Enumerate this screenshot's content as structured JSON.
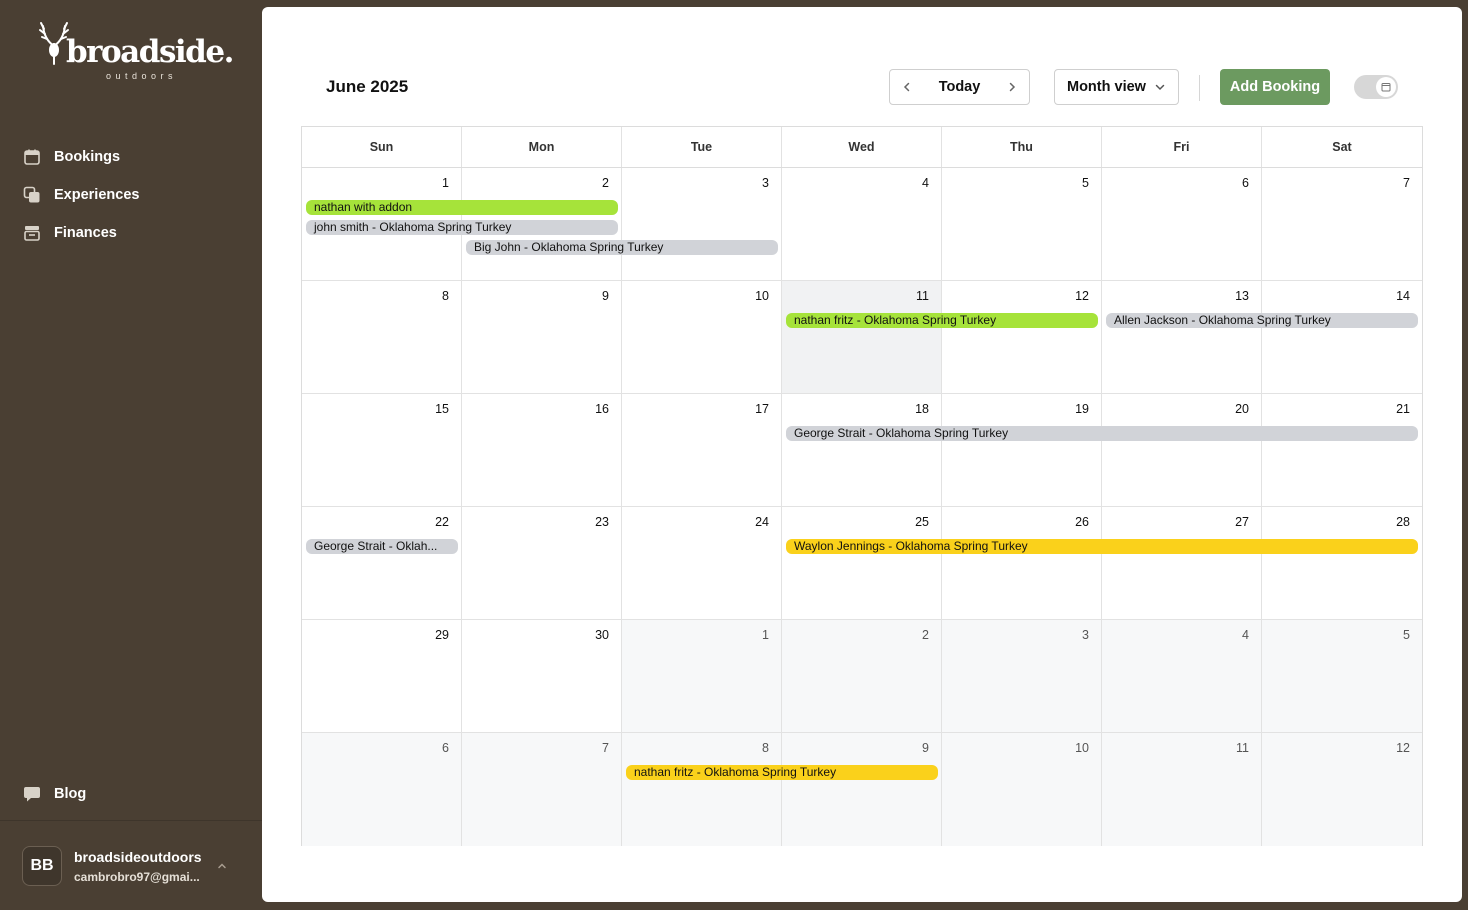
{
  "brand": {
    "name": "broadside.",
    "tagline": "outdoors"
  },
  "nav": [
    {
      "label": "Bookings",
      "icon": "calendar-icon"
    },
    {
      "label": "Experiences",
      "icon": "copy-icon"
    },
    {
      "label": "Finances",
      "icon": "archive-icon"
    }
  ],
  "blog": {
    "label": "Blog",
    "icon": "message-icon"
  },
  "user": {
    "initials": "BB",
    "name": "broadsideoutdoors",
    "email": "cambrobro97@gmai..."
  },
  "header": {
    "title": "June 2025",
    "today_label": "Today",
    "view_label": "Month view",
    "add_label": "Add Booking"
  },
  "colors": {
    "green": "#a6e33a",
    "gray": "#d1d3d8",
    "yellow": "#fad11b",
    "accent": "#6c9a60",
    "sidebar": "#4a3f33"
  },
  "weekdays": [
    "Sun",
    "Mon",
    "Tue",
    "Wed",
    "Thu",
    "Fri",
    "Sat"
  ],
  "days": [
    "1",
    "2",
    "3",
    "4",
    "5",
    "6",
    "7",
    "8",
    "9",
    "10",
    "11",
    "12",
    "13",
    "14",
    "15",
    "16",
    "17",
    "18",
    "19",
    "20",
    "21",
    "22",
    "23",
    "24",
    "25",
    "26",
    "27",
    "28",
    "29",
    "30",
    "1",
    "2",
    "3",
    "4",
    "5",
    "6",
    "7",
    "8",
    "9",
    "10",
    "11",
    "12"
  ],
  "events": [
    {
      "label": "nathan with addon",
      "row": 0,
      "start": 0,
      "span": 2,
      "lane": 0,
      "color": "green"
    },
    {
      "label": "john smith - Oklahoma Spring Turkey",
      "row": 0,
      "start": 0,
      "span": 2,
      "lane": 1,
      "color": "gray"
    },
    {
      "label": "Big John - Oklahoma Spring Turkey",
      "row": 0,
      "start": 1,
      "span": 2,
      "lane": 2,
      "color": "gray"
    },
    {
      "label": "nathan fritz - Oklahoma Spring Turkey",
      "row": 1,
      "start": 3,
      "span": 2,
      "lane": 0,
      "color": "green"
    },
    {
      "label": "Allen Jackson - Oklahoma Spring Turkey",
      "row": 1,
      "start": 5,
      "span": 2,
      "lane": 0,
      "color": "gray"
    },
    {
      "label": "George Strait - Oklahoma Spring Turkey",
      "row": 2,
      "start": 3,
      "span": 4,
      "lane": 0,
      "color": "gray"
    },
    {
      "label": "George Strait - Oklah...",
      "row": 3,
      "start": 0,
      "span": 1,
      "lane": 0,
      "color": "gray"
    },
    {
      "label": "Waylon Jennings - Oklahoma Spring Turkey",
      "row": 3,
      "start": 3,
      "span": 4,
      "lane": 0,
      "color": "yellow"
    },
    {
      "label": "nathan fritz - Oklahoma Spring Turkey",
      "row": 5,
      "start": 2,
      "span": 2,
      "lane": 0,
      "color": "yellow"
    }
  ]
}
